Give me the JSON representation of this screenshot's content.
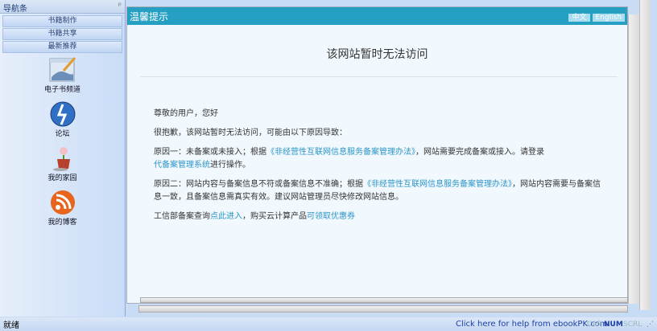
{
  "sidebar": {
    "title": "导航条",
    "pin": "ᵖ",
    "buttons": [
      "书籍制作",
      "书籍共享",
      "最新推荐"
    ],
    "items": [
      {
        "label": "电子书频道",
        "icon": "picture-edit-icon"
      },
      {
        "label": "论坛",
        "icon": "globe-icon"
      },
      {
        "label": "我的家园",
        "icon": "flower-pot-icon"
      },
      {
        "label": "我的博客",
        "icon": "rss-icon"
      }
    ]
  },
  "page": {
    "header": "温馨提示",
    "lang_zh": "中文",
    "lang_en": "English",
    "title": "该网站暂时无法访问",
    "greeting": "尊敬的用户，您好",
    "sorry": "很抱歉，该网站暂时无法访问，可能由以下原因导致：",
    "r1_a": "原因一：未备案或未接入；根据",
    "r1_link": "《非经营性互联网信息服务备案管理办法》",
    "r1_b": "，网站需要完成备案或接入。请登录",
    "r1_link2": "代备案管理系统",
    "r1_c": "进行操作。",
    "r2_a": "原因二：网站内容与备案信息不符或备案信息不准确；根据",
    "r2_link": "《非经营性互联网信息服务备案管理办法》",
    "r2_b": "，网站内容需要与备案信息一致，且备案信息需真实有效。建议网站管理员尽快修改网站信息。",
    "q_a": "工信部备案查询",
    "q_link": "点此进入",
    "q_b": "，购买云计算产品",
    "q_link2": "可领取优惠券"
  },
  "status": {
    "text": "就绪",
    "help": "Click here for help from ebookPK.com",
    "cap": "CAP",
    "num": "NUM",
    "scrl": "SCRL"
  }
}
